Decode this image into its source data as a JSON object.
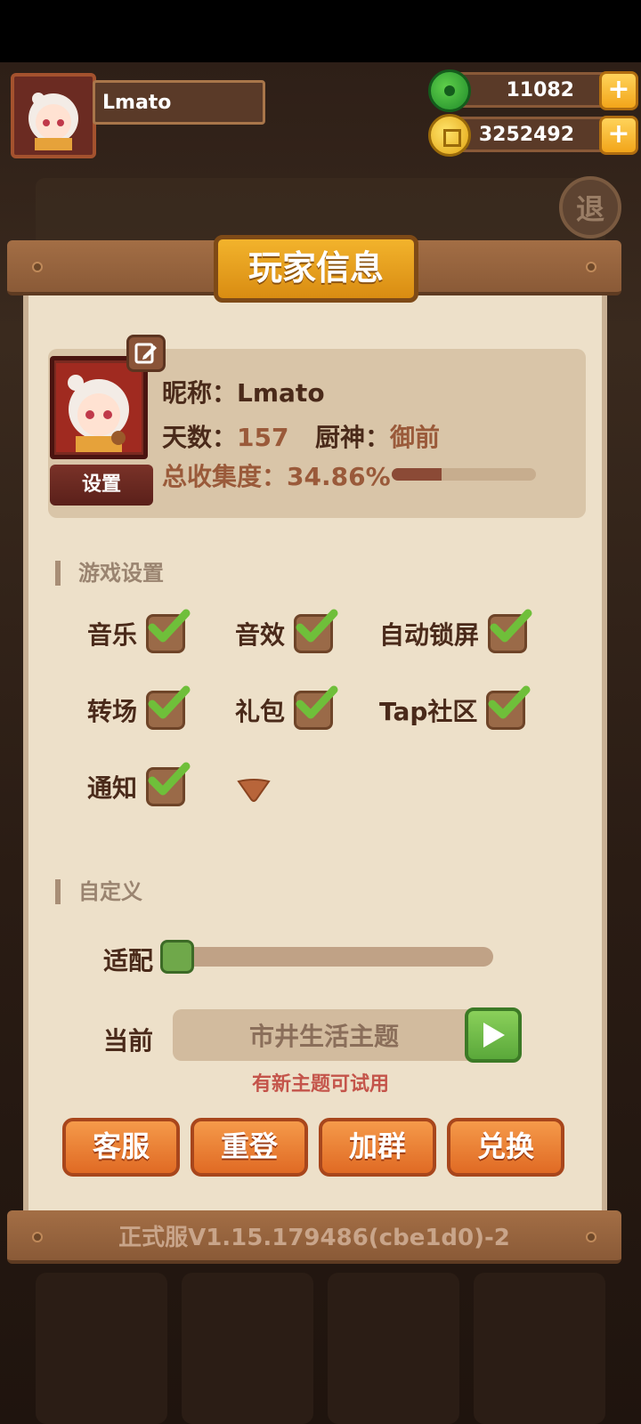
{
  "hud": {
    "player_name": "Lmato",
    "jade_amount": "11082",
    "coin_amount": "3252492",
    "plus_label": "+",
    "exit_label": "退"
  },
  "panel": {
    "title": "玩家信息",
    "avatar_button": "设置",
    "nickname_label": "昵称：",
    "nickname_value": "Lmato",
    "days_label": "天数：",
    "days_value": "157",
    "chef_label": "厨神：",
    "chef_value": "御前",
    "collection_label": "总收集度：",
    "collection_value": "34.86%",
    "collection_progress": 0.3486
  },
  "game_settings": {
    "title": "游戏设置",
    "options": [
      {
        "label": "音乐",
        "checked": true
      },
      {
        "label": "音效",
        "checked": true
      },
      {
        "label": "自动锁屏",
        "checked": true
      },
      {
        "label": "转场",
        "checked": true
      },
      {
        "label": "礼包",
        "checked": true
      },
      {
        "label": "Tap社区",
        "checked": true
      },
      {
        "label": "通知",
        "checked": true
      }
    ]
  },
  "custom": {
    "title": "自定义",
    "fit_label": "适配",
    "fit_level": 0.0,
    "current_label": "当前",
    "current_theme": "市井生活主题",
    "new_theme_tip": "有新主题可试用"
  },
  "actions": {
    "service": "客服",
    "relogin": "重登",
    "join_group": "加群",
    "redeem": "兑换"
  },
  "footer": {
    "version": "正式服V1.15.179486(cbe1d0)-2"
  },
  "colors": {
    "accent_orange": "#e06a24",
    "check_green": "#6fbf3a",
    "panel_bg": "#ede0c9"
  }
}
